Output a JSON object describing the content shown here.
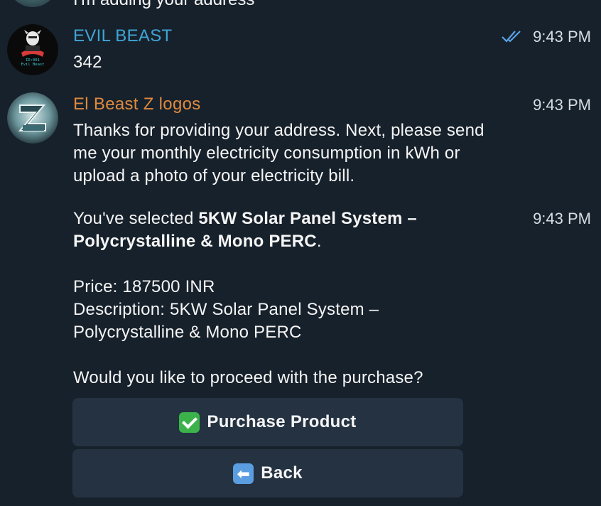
{
  "previous_message": {
    "text": "I'm adding your address"
  },
  "messages": [
    {
      "sender": "EVIL BEAST",
      "sender_color": "#3fa5d6",
      "time": "9:43 PM",
      "read_status": "read-double-check",
      "text": "342",
      "avatar_icon": "evil-beast-avatar",
      "avatar_caption_1": "ID:001",
      "avatar_caption_2": "Evil Beast"
    },
    {
      "sender": "El Beast Z logos",
      "sender_color": "#e08a3f",
      "time": "9:43 PM",
      "avatar_icon": "beast-z-logo-avatar",
      "text": "Thanks for providing your address. Next, please send me your monthly electricity consumption in kWh or upload a photo of your electricity bill."
    },
    {
      "time": "9:43 PM",
      "selected_prefix": "You've selected ",
      "selected_product": "5KW Solar Panel System – Polycrystalline & Mono PERC",
      "selected_suffix": ".",
      "price_line": "Price: 187500 INR",
      "description_line": "Description: 5KW Solar Panel System – Polycrystalline & Mono PERC",
      "question": "Would you like to proceed with the purchase?"
    }
  ],
  "keyboard": {
    "purchase_label": "Purchase Product",
    "purchase_icon": "check-mark-emoji",
    "back_label": "Back",
    "back_icon": "back-arrow-emoji"
  },
  "colors": {
    "background": "#17212b",
    "button_background": "#243242",
    "read_tick": "#5aa2e6"
  }
}
